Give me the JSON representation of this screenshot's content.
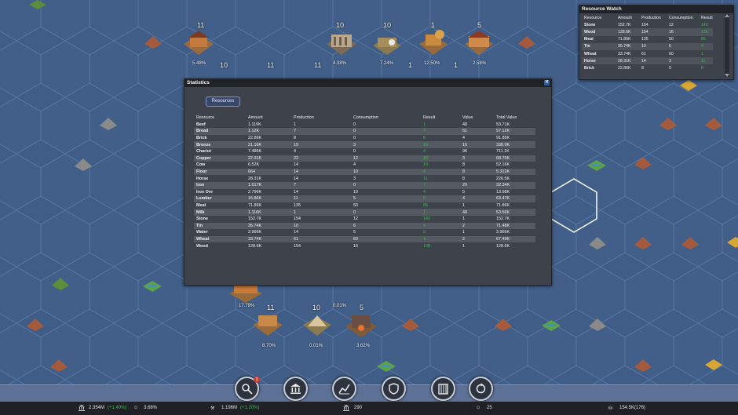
{
  "statistics": {
    "title": "Statistics",
    "tab": "Resources",
    "headers": [
      "Resource",
      "Amount",
      "Production",
      "Consumption",
      "Result",
      "Value",
      "Total Value"
    ],
    "rows": [
      [
        "Beef",
        "1.119K",
        "1",
        "0",
        "1",
        "48",
        "53.71K"
      ],
      [
        "Bread",
        "1.12K",
        "7",
        "0",
        "7",
        "51",
        "57.12K"
      ],
      [
        "Brick",
        "22.86K",
        "8",
        "0",
        "8",
        "4",
        "91.85K"
      ],
      [
        "Bronze",
        "21.16K",
        "19",
        "3",
        "16",
        "16",
        "338.9K"
      ],
      [
        "Chariot",
        "7.486K",
        "4",
        "0",
        "4",
        "96",
        "711.1K"
      ],
      [
        "Copper",
        "22.91K",
        "22",
        "12",
        "10",
        "3",
        "68.75K"
      ],
      [
        "Cow",
        "6.52K",
        "14",
        "4",
        "10",
        "8",
        "52.16K"
      ],
      [
        "Flour",
        "664",
        "14",
        "10",
        "4",
        "8",
        "5.312K"
      ],
      [
        "Horse",
        "28.31K",
        "14",
        "3",
        "11",
        "8",
        "226.5K"
      ],
      [
        "Iron",
        "1.617K",
        "7",
        "0",
        "7",
        "20",
        "32.34K"
      ],
      [
        "Iron Ore",
        "2.796K",
        "14",
        "10",
        "4",
        "5",
        "13.98K"
      ],
      [
        "Lumber",
        "15.86K",
        "11",
        "5",
        "6",
        "4",
        "63.47K"
      ],
      [
        "Meat",
        "71.86K",
        "135",
        "50",
        "85",
        "1",
        "71.86K"
      ],
      [
        "Milk",
        "1.116K",
        "1",
        "0",
        "1",
        "48",
        "53.56K"
      ],
      [
        "Stone",
        "152.7K",
        "154",
        "12",
        "142",
        "1",
        "152.7K"
      ],
      [
        "Tin",
        "35.74K",
        "10",
        "6",
        "4",
        "2",
        "71.48K"
      ],
      [
        "Water",
        "3.966K",
        "14",
        "5",
        "9",
        "1",
        "3.966K"
      ],
      [
        "Wheat",
        "33.74K",
        "61",
        "60",
        "1",
        "2",
        "67.49K"
      ],
      [
        "Wood",
        "128.6K",
        "154",
        "16",
        "138",
        "1",
        "128.6K"
      ]
    ]
  },
  "resource_watch": {
    "title": "Resource Watch",
    "headers": [
      "Resource",
      "Amount",
      "Production",
      "Consumption",
      "Result"
    ],
    "rows": [
      [
        "Stone",
        "152.7K",
        "154",
        "12",
        "142"
      ],
      [
        "Wood",
        "128.6K",
        "154",
        "16",
        "138"
      ],
      [
        "Meat",
        "71.86K",
        "135",
        "50",
        "85"
      ],
      [
        "Tin",
        "35.74K",
        "10",
        "6",
        "4"
      ],
      [
        "Wheat",
        "33.74K",
        "61",
        "60",
        "1"
      ],
      [
        "Horse",
        "28.31K",
        "14",
        "3",
        "11"
      ],
      [
        "Brick",
        "22.86K",
        "8",
        "0",
        "8"
      ]
    ]
  },
  "map_labels": {
    "n1": "11",
    "n2": "10",
    "n3": "10",
    "n4": "1",
    "n5": "5",
    "n6": "10",
    "n7": "11",
    "n8": "11",
    "n9": "1",
    "n10": "1",
    "n11": "11",
    "n12": "10",
    "n13": "5",
    "p1": "5.48%",
    "p2": "4.38%",
    "p3": "7.24%",
    "p4": "12.50%",
    "p5": "2.58%",
    "p6": "17.79%",
    "p7": "0.01%",
    "p8": "8.70%",
    "p9": "0.01%",
    "p10": "3.62%"
  },
  "dock": {
    "notification_count": "3"
  },
  "status_bar": {
    "population": "2.354M",
    "population_change": "(+1.40%)",
    "happiness": "3.68%",
    "workers": "1.196M",
    "workers_change": "(+1.20%)",
    "buildings": "290",
    "faith": "25",
    "treasury": "154.5K(176)"
  },
  "colors": {
    "accent": "#2c5a9c",
    "positive": "#3fb64f",
    "map_water": "#3f5d86"
  }
}
